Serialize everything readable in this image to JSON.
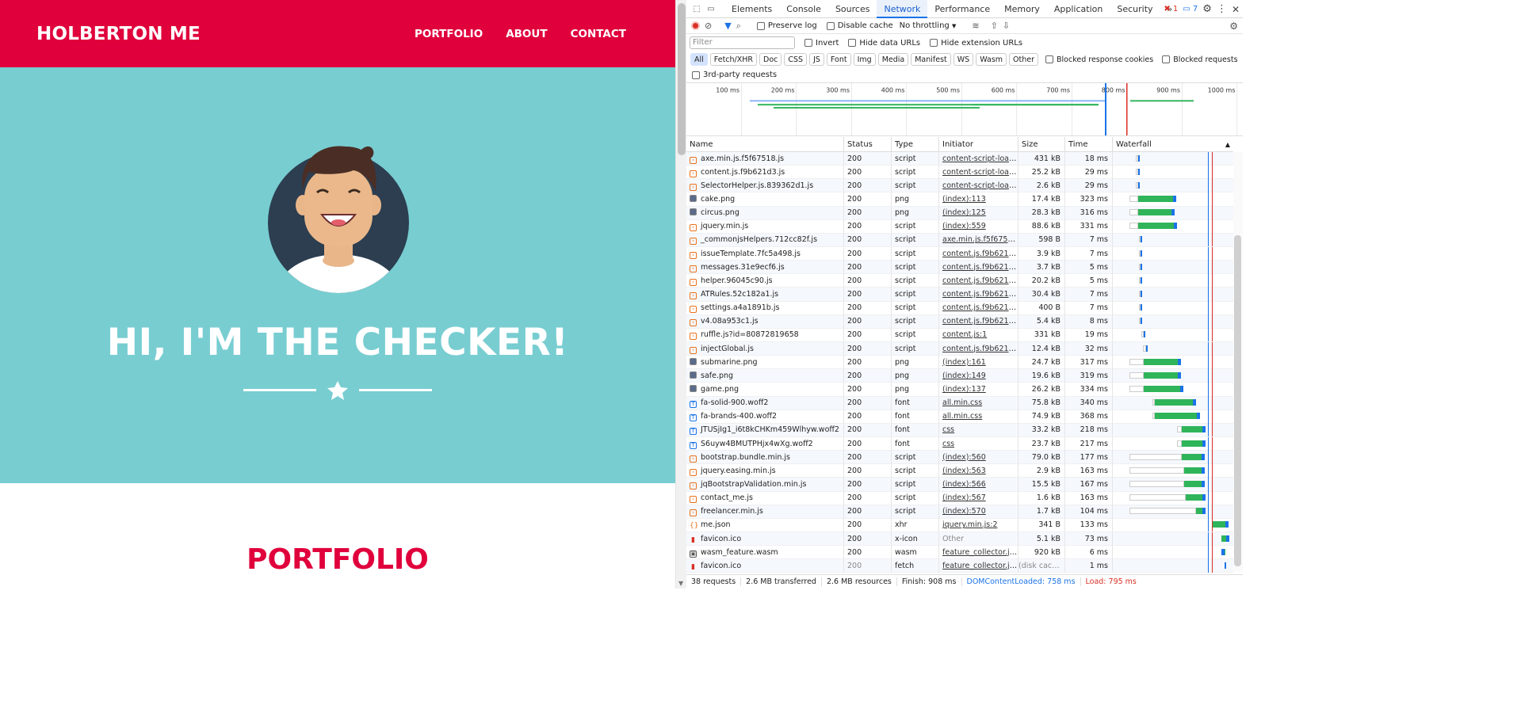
{
  "site": {
    "brand": "HOLBERTON ME",
    "nav": [
      "PORTFOLIO",
      "ABOUT",
      "CONTACT"
    ],
    "hero_title": "HI, I'M THE CHECKER!",
    "portfolio_title": "PORTFOLIO"
  },
  "colors": {
    "brand_red": "#e0003c",
    "hero_teal": "#78cdd1",
    "dt_blue": "#1a73e8",
    "wf_green": "#2fb45a"
  },
  "devtools": {
    "tabs": [
      "Elements",
      "Console",
      "Sources",
      "Network",
      "Performance",
      "Memory",
      "Application",
      "Security"
    ],
    "active_tab": "Network",
    "error_count": "1",
    "message_count": "7",
    "toolbar": {
      "preserve_log": "Preserve log",
      "disable_cache": "Disable cache",
      "throttling": "No throttling"
    },
    "filter": {
      "placeholder": "Filter",
      "invert": "Invert",
      "hide_data_urls": "Hide data URLs",
      "hide_ext_urls": "Hide extension URLs"
    },
    "type_filters": [
      "All",
      "Fetch/XHR",
      "Doc",
      "CSS",
      "JS",
      "Font",
      "Img",
      "Media",
      "Manifest",
      "WS",
      "Wasm",
      "Other"
    ],
    "blocked_cookies": "Blocked response cookies",
    "blocked_requests": "Blocked requests",
    "third_party": "3rd-party requests",
    "timeline_ticks": [
      "100 ms",
      "200 ms",
      "300 ms",
      "400 ms",
      "500 ms",
      "600 ms",
      "700 ms",
      "800 ms",
      "900 ms",
      "1000 ms"
    ],
    "columns": [
      "Name",
      "Status",
      "Type",
      "Initiator",
      "Size",
      "Time",
      "Waterfall"
    ],
    "rows": [
      {
        "name": "axe.min.js.f5f67518.js",
        "status": "200",
        "type": "script",
        "initiator": "content-script-load...",
        "size": "431 kB",
        "time": "18 ms",
        "wf": [
          0.19,
          0.02,
          0.0
        ]
      },
      {
        "name": "content.js.f9b621d3.js",
        "status": "200",
        "type": "script",
        "initiator": "content-script-load...",
        "size": "25.2 kB",
        "time": "29 ms",
        "wf": [
          0.19,
          0.02,
          0.0
        ]
      },
      {
        "name": "SelectorHelper.js.839362d1.js",
        "status": "200",
        "type": "script",
        "initiator": "content-script-load...",
        "size": "2.6 kB",
        "time": "29 ms",
        "wf": [
          0.19,
          0.02,
          0.0
        ]
      },
      {
        "name": "cake.png",
        "status": "200",
        "type": "png",
        "initiator": "(index):113",
        "size": "17.4 kB",
        "time": "323 ms",
        "wf": [
          0.14,
          0.07,
          0.32
        ]
      },
      {
        "name": "circus.png",
        "status": "200",
        "type": "png",
        "initiator": "(index):125",
        "size": "28.3 kB",
        "time": "316 ms",
        "wf": [
          0.14,
          0.07,
          0.31
        ]
      },
      {
        "name": "jquery.min.js",
        "status": "200",
        "type": "script",
        "initiator": "(index):559",
        "size": "88.6 kB",
        "time": "331 ms",
        "wf": [
          0.14,
          0.07,
          0.33
        ]
      },
      {
        "name": "_commonjsHelpers.712cc82f.js",
        "status": "200",
        "type": "script",
        "initiator": "axe.min.js.f5f67518...",
        "size": "598 B",
        "time": "7 ms",
        "wf": [
          0.22,
          0.01,
          0.0
        ]
      },
      {
        "name": "issueTemplate.7fc5a498.js",
        "status": "200",
        "type": "script",
        "initiator": "content.js.f9b621d...",
        "size": "3.9 kB",
        "time": "7 ms",
        "wf": [
          0.22,
          0.01,
          0.0
        ]
      },
      {
        "name": "messages.31e9ecf6.js",
        "status": "200",
        "type": "script",
        "initiator": "content.js.f9b621d...",
        "size": "3.7 kB",
        "time": "5 ms",
        "wf": [
          0.22,
          0.01,
          0.0
        ]
      },
      {
        "name": "helper.96045c90.js",
        "status": "200",
        "type": "script",
        "initiator": "content.js.f9b621d...",
        "size": "20.2 kB",
        "time": "5 ms",
        "wf": [
          0.22,
          0.01,
          0.0
        ]
      },
      {
        "name": "ATRules.52c182a1.js",
        "status": "200",
        "type": "script",
        "initiator": "content.js.f9b621d...",
        "size": "30.4 kB",
        "time": "7 ms",
        "wf": [
          0.22,
          0.01,
          0.0
        ]
      },
      {
        "name": "settings.a4a1891b.js",
        "status": "200",
        "type": "script",
        "initiator": "content.js.f9b621d...",
        "size": "400 B",
        "time": "7 ms",
        "wf": [
          0.22,
          0.01,
          0.0
        ]
      },
      {
        "name": "v4.08a953c1.js",
        "status": "200",
        "type": "script",
        "initiator": "content.js.f9b621d...",
        "size": "5.4 kB",
        "time": "8 ms",
        "wf": [
          0.22,
          0.01,
          0.0
        ]
      },
      {
        "name": "ruffle.js?id=80872819658",
        "status": "200",
        "type": "script",
        "initiator": "content.js:1",
        "size": "331 kB",
        "time": "19 ms",
        "wf": [
          0.24,
          0.02,
          0.0
        ]
      },
      {
        "name": "injectGlobal.js",
        "status": "200",
        "type": "script",
        "initiator": "content.js.f9b621d...",
        "size": "12.4 kB",
        "time": "32 ms",
        "wf": [
          0.25,
          0.03,
          0.0
        ]
      },
      {
        "name": "submarine.png",
        "status": "200",
        "type": "png",
        "initiator": "(index):161",
        "size": "24.7 kB",
        "time": "317 ms",
        "wf": [
          0.14,
          0.12,
          0.31
        ]
      },
      {
        "name": "safe.png",
        "status": "200",
        "type": "png",
        "initiator": "(index):149",
        "size": "19.6 kB",
        "time": "319 ms",
        "wf": [
          0.14,
          0.12,
          0.31
        ]
      },
      {
        "name": "game.png",
        "status": "200",
        "type": "png",
        "initiator": "(index):137",
        "size": "26.2 kB",
        "time": "334 ms",
        "wf": [
          0.14,
          0.12,
          0.33
        ]
      },
      {
        "name": "fa-solid-900.woff2",
        "status": "200",
        "type": "font",
        "initiator": "all.min.css",
        "size": "75.8 kB",
        "time": "340 ms",
        "wf": [
          0.33,
          0.02,
          0.35
        ]
      },
      {
        "name": "fa-brands-400.woff2",
        "status": "200",
        "type": "font",
        "initiator": "all.min.css",
        "size": "74.9 kB",
        "time": "368 ms",
        "wf": [
          0.33,
          0.02,
          0.38
        ]
      },
      {
        "name": "JTUSjIg1_i6t8kCHKm459Wlhyw.woff2",
        "status": "200",
        "type": "font",
        "initiator": "css",
        "size": "33.2 kB",
        "time": "218 ms",
        "wf": [
          0.54,
          0.04,
          0.2
        ]
      },
      {
        "name": "S6uyw4BMUTPHjx4wXg.woff2",
        "status": "200",
        "type": "font",
        "initiator": "css",
        "size": "23.7 kB",
        "time": "217 ms",
        "wf": [
          0.54,
          0.04,
          0.2
        ]
      },
      {
        "name": "bootstrap.bundle.min.js",
        "status": "200",
        "type": "script",
        "initiator": "(index):560",
        "size": "79.0 kB",
        "time": "177 ms",
        "wf": [
          0.14,
          0.44,
          0.19
        ]
      },
      {
        "name": "jquery.easing.min.js",
        "status": "200",
        "type": "script",
        "initiator": "(index):563",
        "size": "2.9 kB",
        "time": "163 ms",
        "wf": [
          0.14,
          0.46,
          0.17
        ]
      },
      {
        "name": "jqBootstrapValidation.min.js",
        "status": "200",
        "type": "script",
        "initiator": "(index):566",
        "size": "15.5 kB",
        "time": "167 ms",
        "wf": [
          0.14,
          0.46,
          0.17
        ]
      },
      {
        "name": "contact_me.js",
        "status": "200",
        "type": "script",
        "initiator": "(index):567",
        "size": "1.6 kB",
        "time": "163 ms",
        "wf": [
          0.14,
          0.47,
          0.17
        ]
      },
      {
        "name": "freelancer.min.js",
        "status": "200",
        "type": "script",
        "initiator": "(index):570",
        "size": "1.7 kB",
        "time": "104 ms",
        "wf": [
          0.14,
          0.56,
          0.08
        ]
      },
      {
        "name": "me.json",
        "status": "200",
        "type": "xhr",
        "initiator": "jquery.min.js:2",
        "size": "341 B",
        "time": "133 ms",
        "wf": [
          0.83,
          0.0,
          0.14
        ]
      },
      {
        "name": "favicon.ico",
        "status": "200",
        "type": "x-icon",
        "initiator": "Other",
        "size": "5.1 kB",
        "time": "73 ms",
        "wf": [
          0.91,
          0.0,
          0.07
        ]
      },
      {
        "name": "wasm_feature.wasm",
        "status": "200",
        "type": "wasm",
        "initiator": "feature_collector.js:...",
        "size": "920 kB",
        "time": "6 ms",
        "wf": [
          0.93,
          0.0,
          0.01
        ]
      },
      {
        "name": "favicon.ico",
        "status": "200",
        "type": "fetch",
        "initiator": "feature_collector.js:...",
        "size": "(disk cache)",
        "time": "1 ms",
        "wf": [
          0.94,
          0.0,
          0.0
        ]
      }
    ],
    "status": {
      "requests": "38 requests",
      "transferred": "2.6 MB transferred",
      "resources": "2.6 MB resources",
      "finish": "Finish: 908 ms",
      "dcl": "DOMContentLoaded: 758 ms",
      "load": "Load: 795 ms"
    }
  }
}
